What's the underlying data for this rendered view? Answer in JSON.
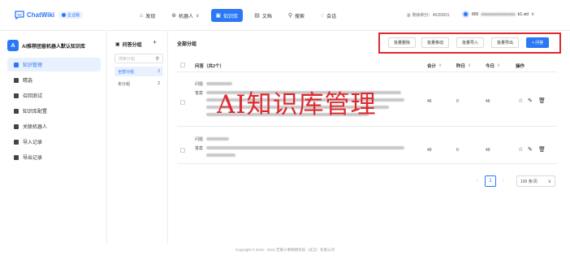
{
  "app": {
    "name": "ChatWiki",
    "badge": "企业版",
    "brand_color": "#2b78f6",
    "highlight_color": "#e0282e"
  },
  "nav": {
    "items": [
      {
        "label": "发现",
        "icon": "compass-icon"
      },
      {
        "label": "机器人",
        "icon": "robot-icon"
      },
      {
        "label": "知识库",
        "icon": "book-icon"
      },
      {
        "label": "文档",
        "icon": "document-icon"
      },
      {
        "label": "搜索",
        "icon": "search-icon"
      },
      {
        "label": "会话",
        "icon": "chat-icon"
      }
    ],
    "active": "知识库"
  },
  "header": {
    "usage": "剩余积分：4635/831",
    "user_prefix": "800",
    "user_suffix": "b1.xid"
  },
  "robot": {
    "name": "AI推荐团留机器人默认知识库",
    "icon_letter": "A"
  },
  "sidebar": {
    "items": [
      {
        "label": "知识管理",
        "active": true
      },
      {
        "label": "精选"
      },
      {
        "label": "召回测试"
      },
      {
        "label": "知识库配置"
      },
      {
        "label": "关联机器人"
      },
      {
        "label": "导入记录"
      },
      {
        "label": "导出记录"
      }
    ]
  },
  "groups": {
    "title": "问答分组",
    "search_placeholder": "搜索分组",
    "items": [
      {
        "label": "全部分组",
        "count": "2",
        "active": true
      },
      {
        "label": "未分组",
        "count": "2"
      }
    ]
  },
  "main": {
    "title": "全部分组",
    "buttons": {
      "batch_delete": "批量删除",
      "batch_move": "批量移动",
      "batch_import": "批量导入",
      "batch_export": "批量导出",
      "add_qa": "+ 问答"
    },
    "columns": {
      "qa": "问答（共2个）",
      "total": "合计",
      "yesterday": "昨日",
      "today": "今日",
      "actions": "操作"
    },
    "row_labels": {
      "question": "问题",
      "answer": "答案"
    },
    "rows": [
      {
        "total": "46",
        "yesterday": "0",
        "today": "46"
      },
      {
        "total": "49",
        "yesterday": "0",
        "today": "49"
      }
    ],
    "overlay_text": "AI知识库管理"
  },
  "pagination": {
    "prev": "‹",
    "page": "1",
    "next": "›",
    "page_size": "100 条/页"
  },
  "footer": "Copyright © 2016 - 2024 芝麻小事网络科技（武汉）有限公司"
}
